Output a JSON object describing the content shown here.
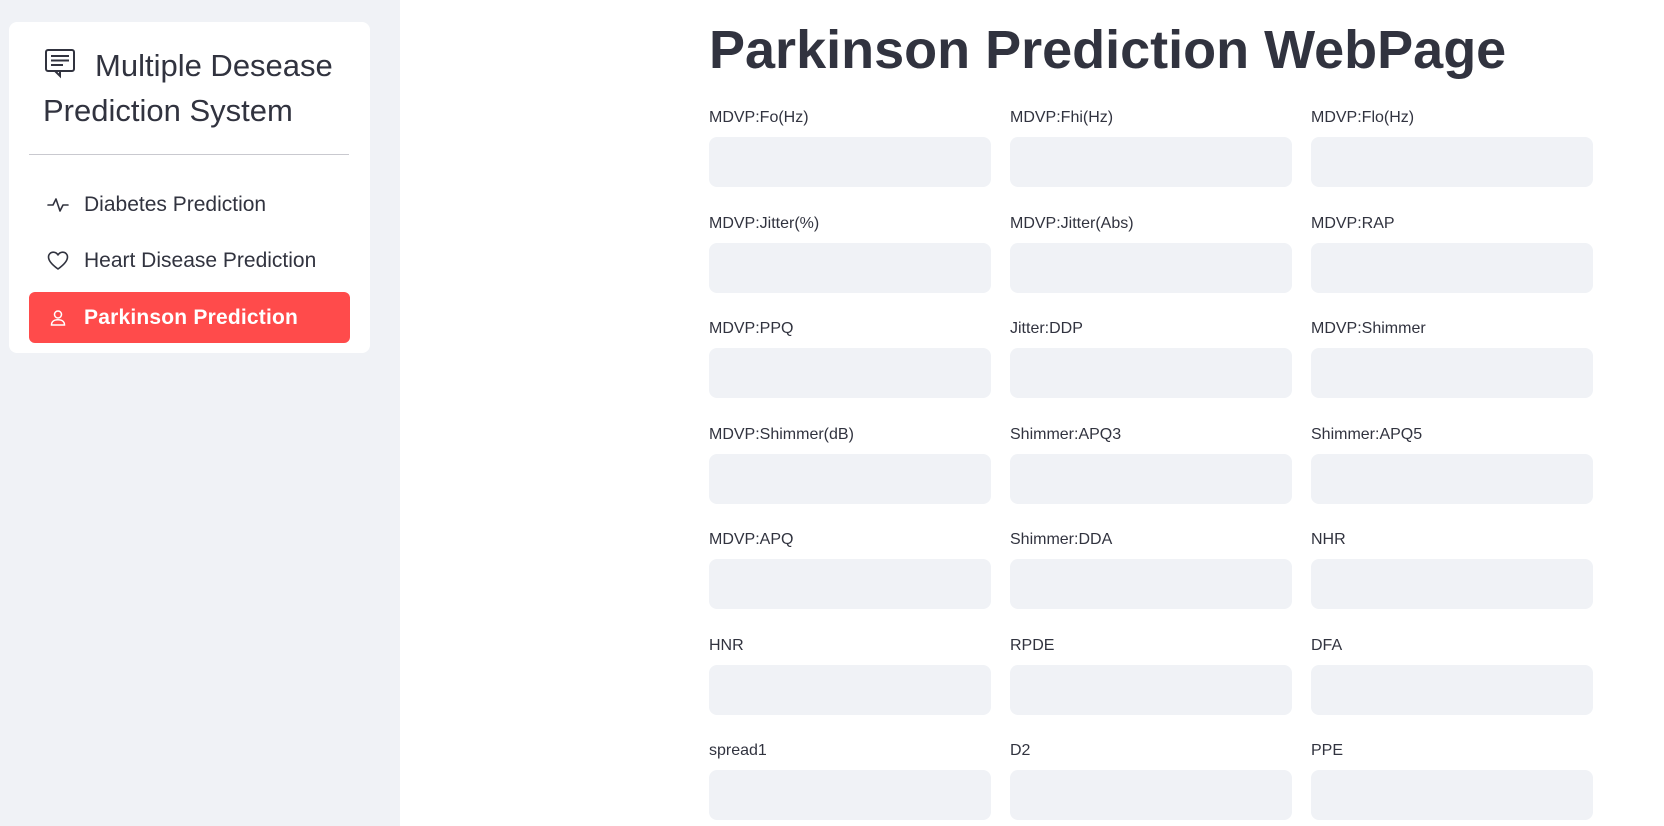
{
  "sidebar": {
    "title": "Multiple Desease Prediction System",
    "title_icon": "chat-text-icon",
    "items": [
      {
        "label": "Diabetes Prediction",
        "icon": "activity-icon",
        "active": false
      },
      {
        "label": "Heart Disease Prediction",
        "icon": "heart-icon",
        "active": false
      },
      {
        "label": "Parkinson Prediction",
        "icon": "person-icon",
        "active": true
      }
    ],
    "accent_color": "#ff4b4b"
  },
  "main": {
    "title": "Parkinson Prediction WebPage",
    "fields": [
      {
        "label": "MDVP:Fo(Hz)",
        "value": ""
      },
      {
        "label": "MDVP:Fhi(Hz)",
        "value": ""
      },
      {
        "label": "MDVP:Flo(Hz)",
        "value": ""
      },
      {
        "label": "MDVP:Jitter(%)",
        "value": ""
      },
      {
        "label": "MDVP:Jitter(Abs)",
        "value": ""
      },
      {
        "label": "MDVP:RAP",
        "value": ""
      },
      {
        "label": "MDVP:PPQ",
        "value": ""
      },
      {
        "label": "Jitter:DDP",
        "value": ""
      },
      {
        "label": "MDVP:Shimmer",
        "value": ""
      },
      {
        "label": "MDVP:Shimmer(dB)",
        "value": ""
      },
      {
        "label": "Shimmer:APQ3",
        "value": ""
      },
      {
        "label": "Shimmer:APQ5",
        "value": ""
      },
      {
        "label": "MDVP:APQ",
        "value": ""
      },
      {
        "label": "Shimmer:DDA",
        "value": ""
      },
      {
        "label": "NHR",
        "value": ""
      },
      {
        "label": "HNR",
        "value": ""
      },
      {
        "label": "RPDE",
        "value": ""
      },
      {
        "label": "DFA",
        "value": ""
      },
      {
        "label": "spread1",
        "value": ""
      },
      {
        "label": "D2",
        "value": ""
      },
      {
        "label": "PPE",
        "value": ""
      }
    ]
  }
}
